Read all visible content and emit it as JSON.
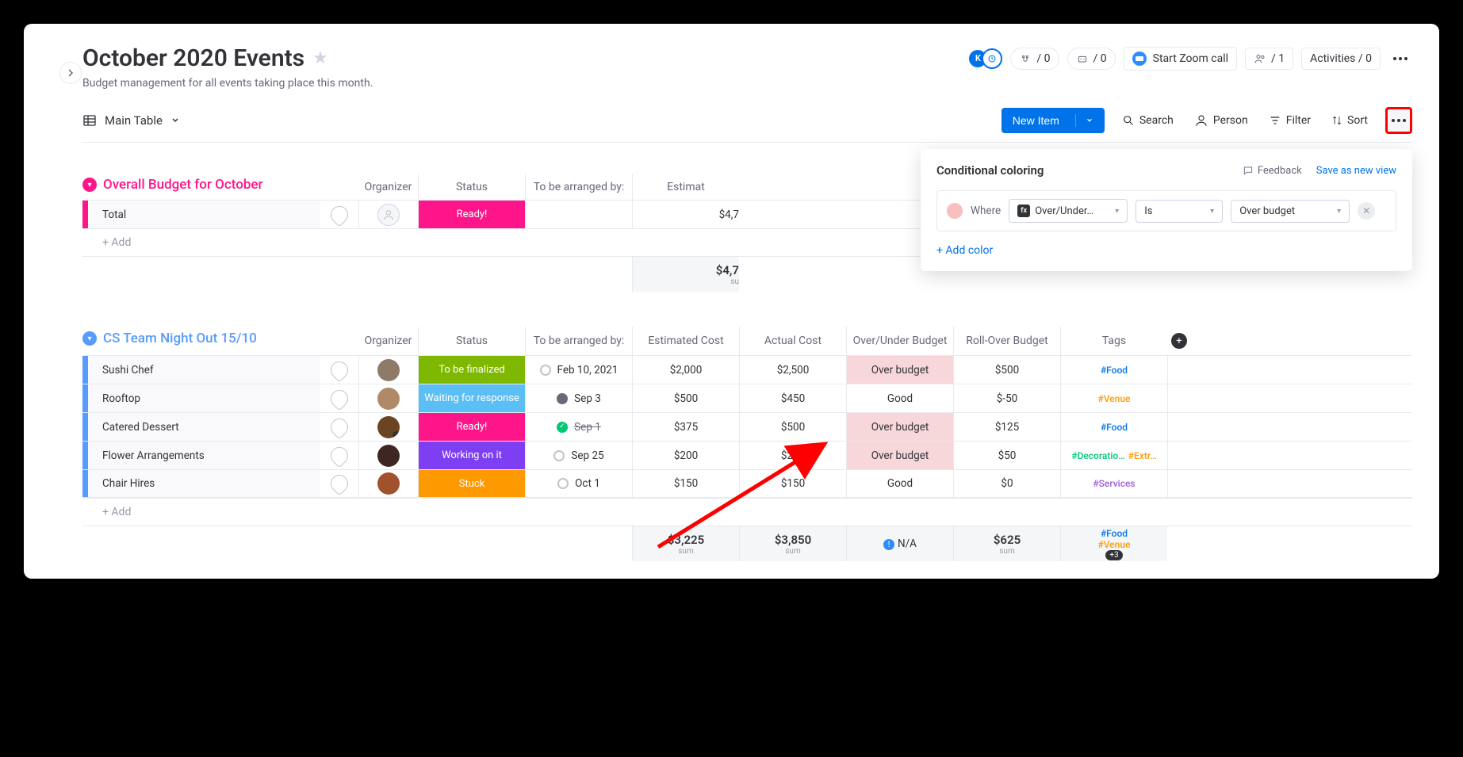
{
  "header": {
    "title": "October 2020 Events",
    "subtitle": "Budget management for all events taking place this month.",
    "robot_count": "/ 0",
    "robot2_count": "/ 0",
    "zoom_label": "Start Zoom call",
    "people_count": "/ 1",
    "activities_label": "Activities / 0",
    "avatar_initial": "K"
  },
  "viewbar": {
    "view_name": "Main Table",
    "new_item": "New Item",
    "search": "Search",
    "person": "Person",
    "filter": "Filter",
    "sort": "Sort"
  },
  "columns": {
    "organizer": "Organizer",
    "status": "Status",
    "arranged": "To be arranged by:",
    "estimated": "Estimated Cost",
    "actual": "Actual Cost",
    "over_under": "Over/Under Budget",
    "rollover": "Roll-Over Budget",
    "tags": "Tags"
  },
  "group1": {
    "color": "#ff158a",
    "title": "Overall Budget for October",
    "row_name": "Total",
    "status_label": "Ready!",
    "status_color": "#ff158a",
    "estimated_partial": "$4,7",
    "sum_partial": "$4,7",
    "sum_label": "su",
    "add_label": "+ Add"
  },
  "group2": {
    "color": "#579bfc",
    "title": "CS Team Night Out 15/10",
    "rows": [
      {
        "name": "Sushi Chef",
        "avatar_color": "#8d7b68",
        "status": "To be finalized",
        "status_color": "#7fb800",
        "date_icon": "open",
        "date": "Feb 10, 2021",
        "estimated": "$2,000",
        "actual": "$2,500",
        "over_under": "Over budget",
        "highlight": true,
        "rollover": "$500",
        "tags": [
          {
            "t": "#Food",
            "c": "#0073ea"
          }
        ]
      },
      {
        "name": "Rooftop",
        "avatar_color": "#b08968",
        "status": "Waiting for response",
        "status_color": "#5bbff5",
        "date_icon": "dark",
        "date": "Sep 3",
        "estimated": "$500",
        "actual": "$450",
        "over_under": "Good",
        "highlight": false,
        "rollover": "$-50",
        "tags": [
          {
            "t": "#Venue",
            "c": "#ff9900"
          }
        ]
      },
      {
        "name": "Catered Dessert",
        "avatar_color": "#6b4423",
        "avatar_badge": true,
        "status": "Ready!",
        "status_color": "#ff158a",
        "date_icon": "done",
        "date": "Sep 1",
        "date_strike": true,
        "estimated": "$375",
        "actual": "$500",
        "over_under": "Over budget",
        "highlight": true,
        "rollover": "$125",
        "tags": [
          {
            "t": "#Food",
            "c": "#0073ea"
          }
        ]
      },
      {
        "name": "Flower Arrangements",
        "avatar_color": "#3e2723",
        "status": "Working on it",
        "status_color": "#7e3ff2",
        "date_icon": "open",
        "date": "Sep 25",
        "estimated": "$200",
        "actual": "$250",
        "over_under": "Over budget",
        "highlight": true,
        "rollover": "$50",
        "tags": [
          {
            "t": "#Decoratio…",
            "c": "#00c875"
          },
          {
            "t": "#Extr…",
            "c": "#ff9900"
          }
        ]
      },
      {
        "name": "Chair Hires",
        "avatar_color": "#a0522d",
        "status": "Stuck",
        "status_color": "#ff9900",
        "date_icon": "open",
        "date": "Oct 1",
        "estimated": "$150",
        "actual": "$150",
        "actual_strike_partial": true,
        "over_under": "Good",
        "highlight": false,
        "rollover": "$0",
        "tags": [
          {
            "t": "#Services",
            "c": "#a25ddc"
          }
        ]
      }
    ],
    "add_label": "+ Add",
    "sums": {
      "estimated": "$3,225",
      "actual": "$3,850",
      "over_under": "N/A",
      "rollover": "$625",
      "tags": [
        {
          "t": "#Food",
          "c": "#0073ea"
        },
        {
          "t": "#Venue",
          "c": "#ff9900"
        }
      ],
      "tags_more": "+3"
    },
    "sum_label": "sum"
  },
  "popup": {
    "title": "Conditional coloring",
    "feedback": "Feedback",
    "save": "Save as new view",
    "where": "Where",
    "column": "Over/Under…",
    "operator": "Is",
    "value": "Over budget",
    "add_color": "+ Add color"
  }
}
